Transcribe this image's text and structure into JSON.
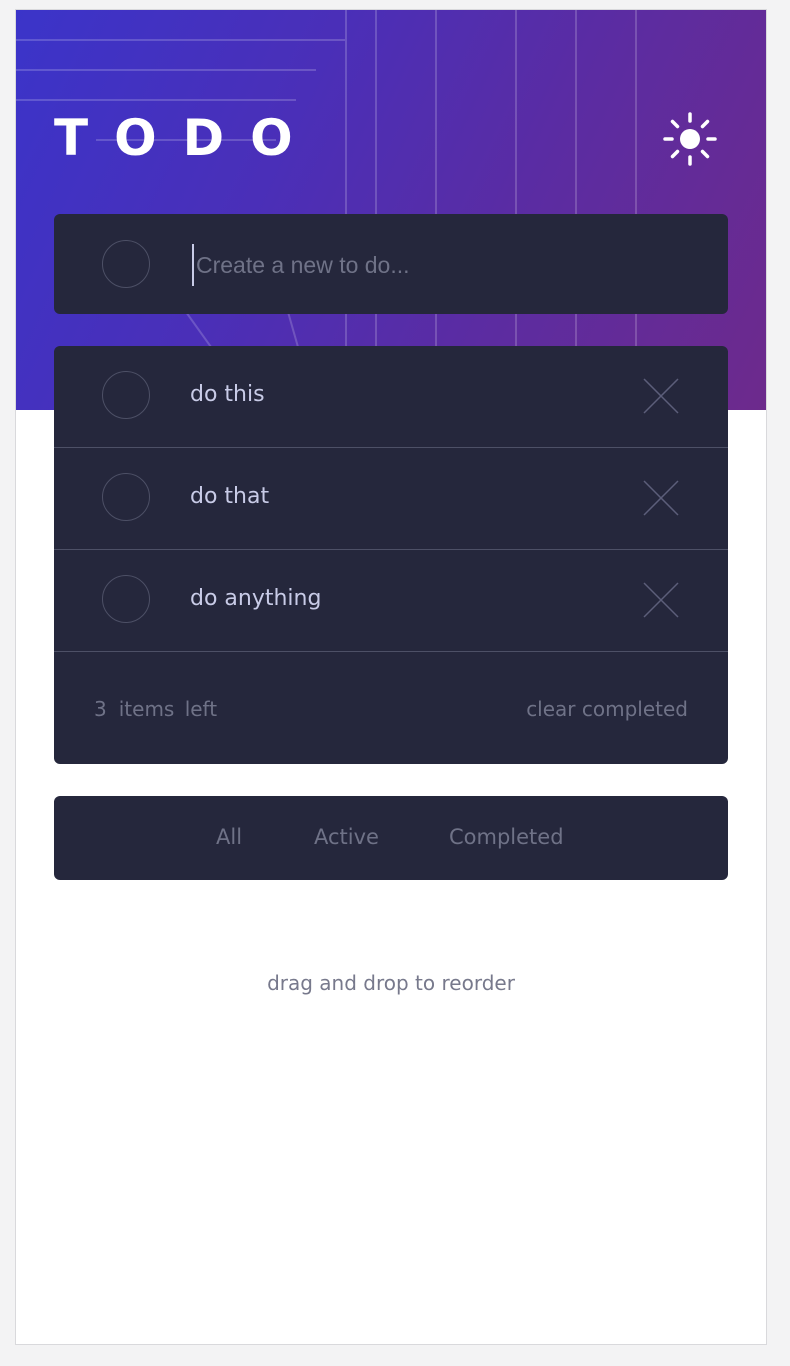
{
  "header": {
    "title": "TODO",
    "theme_toggle_icon": "sun-icon"
  },
  "new_todo": {
    "placeholder": "Create a new to do...",
    "value": ""
  },
  "todos": [
    {
      "label": "do this",
      "completed": false
    },
    {
      "label": "do that",
      "completed": false
    },
    {
      "label": "do anything",
      "completed": false
    }
  ],
  "footer": {
    "count": "3",
    "items_left_label": "items left",
    "clear_label": "clear completed"
  },
  "filters": {
    "all": "All",
    "active": "Active",
    "completed": "Completed"
  },
  "hint": "drag and drop to reorder",
  "colors": {
    "card_bg": "#25273c",
    "text": "#c8cbe7",
    "muted": "#6f7287",
    "gradient_start": "#3b34c9",
    "gradient_end": "#6d2a8c"
  }
}
